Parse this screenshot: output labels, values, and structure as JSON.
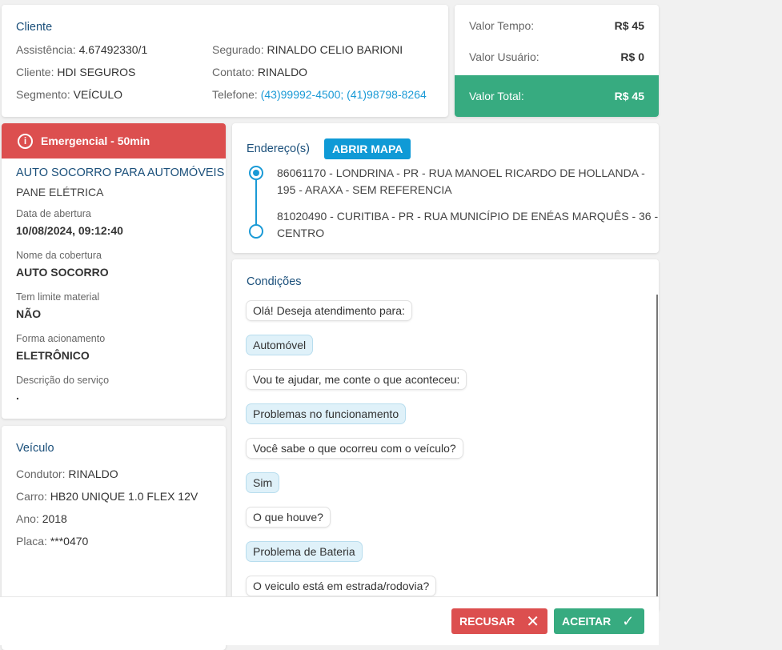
{
  "cliente": {
    "title": "Cliente",
    "assistencia_label": "Assistência:",
    "assistencia": "4.67492330/1",
    "cliente_label": "Cliente:",
    "cliente": "HDI SEGUROS",
    "segmento_label": "Segmento:",
    "segmento": "VEÍCULO",
    "segurado_label": "Segurado:",
    "segurado": "RINALDO CELIO BARIONI",
    "contato_label": "Contato:",
    "contato": "RINALDO",
    "telefone_label": "Telefone:",
    "telefone": "(43)99992-4500; (41)98798-8264"
  },
  "valores": {
    "tempo_label": "Valor Tempo:",
    "tempo": "R$ 45",
    "usuario_label": "Valor Usuário:",
    "usuario": "R$ 0",
    "total_label": "Valor Total:",
    "total": "R$ 45",
    "total_color": "#37ab80"
  },
  "servico": {
    "alert": "Emergencial - 50min",
    "alert_color": "#dc4f4f",
    "name": "AUTO SOCORRO PARA AUTOMÓVEIS",
    "problem": "PANE ELÉTRICA",
    "fields": [
      {
        "label": "Data de abertura",
        "value": "10/08/2024, 09:12:40"
      },
      {
        "label": "Nome da cobertura",
        "value": "AUTO SOCORRO"
      },
      {
        "label": "Tem limite material",
        "value": "NÃO"
      },
      {
        "label": "Forma acionamento",
        "value": "ELETRÔNICO"
      },
      {
        "label": "Descrição do serviço",
        "value": "."
      }
    ]
  },
  "veiculo": {
    "title": "Veículo",
    "condutor_label": "Condutor:",
    "condutor": "RINALDO",
    "carro_label": "Carro:",
    "carro": "HB20 UNIQUE 1.0 FLEX 12V",
    "ano_label": "Ano:",
    "ano": "2018",
    "placa_label": "Placa:",
    "placa": "***0470"
  },
  "enderecos": {
    "title": "Endereço(s)",
    "map_button": "ABRIR MAPA",
    "items": [
      {
        "line1": "86061170 - LONDRINA - PR - RUA MANOEL RICARDO DE HOLLANDA -",
        "line2": "195 - ARAXA - SEM REFERENCIA"
      },
      {
        "line1": "81020490 - CURITIBA - PR - RUA MUNICÍPIO DE ENÉAS MARQUÊS - 36 -",
        "line2": "CENTRO"
      }
    ]
  },
  "condicoes": {
    "title": "Condições",
    "messages": [
      {
        "text": "Olá! Deseja atendimento para:",
        "answer": false
      },
      {
        "text": "Automóvel",
        "answer": true
      },
      {
        "text": "Vou te ajudar, me conte o que aconteceu:",
        "answer": false
      },
      {
        "text": "Problemas no funcionamento",
        "answer": true
      },
      {
        "text": "Você sabe o que ocorreu com o veículo?",
        "answer": false
      },
      {
        "text": "Sim",
        "answer": true
      },
      {
        "text": "O que houve?",
        "answer": false
      },
      {
        "text": "Problema de Bateria",
        "answer": true
      },
      {
        "text": "O veiculo está em estrada/rodovia?",
        "answer": false
      }
    ]
  },
  "actions": {
    "refuse": "RECUSAR",
    "accept": "ACEITAR"
  }
}
